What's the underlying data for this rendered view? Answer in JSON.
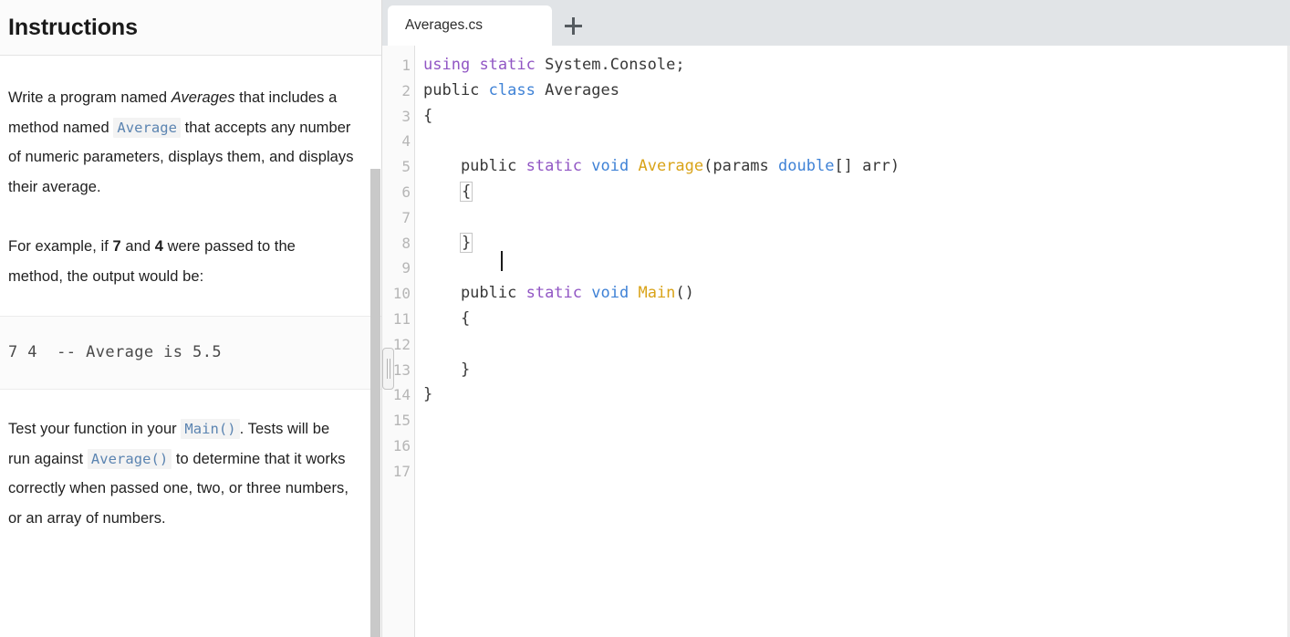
{
  "instructions": {
    "title": "Instructions",
    "paragraph1": {
      "before_em": "Write a program named ",
      "em": "Averages",
      "after_em": " that includes a method named ",
      "code": "Average",
      "tail": " that accepts any number of numeric parameters, displays them, and displays their average."
    },
    "paragraph2": {
      "before_b1": "For example, if ",
      "b1": "7",
      "between": " and ",
      "b2": "4",
      "tail": " were passed to the method, the output would be:"
    },
    "sample_output": "7 4  -- Average is 5.5",
    "paragraph3": {
      "before_code1": "Test your function in your ",
      "code1": "Main()",
      "between_codes": ". Tests will be run against ",
      "code2": "Average()",
      "tail": " to determine that it works correctly when passed one, two, or three numbers, or an array of numbers."
    }
  },
  "editor": {
    "tabs": [
      {
        "label": "Averages.cs",
        "active": true
      }
    ],
    "new_tab_icon": "plus-icon",
    "splitter_icon": "drag-handle-icon",
    "line_numbers": [
      "1",
      "2",
      "3",
      "4",
      "5",
      "6",
      "7",
      "8",
      "9",
      "10",
      "11",
      "12",
      "13",
      "14",
      "15",
      "16",
      "17"
    ],
    "code_lines": [
      {
        "n": 1,
        "tokens": [
          {
            "t": "using",
            "c": "kw-purple"
          },
          {
            "t": " ",
            "c": "plain"
          },
          {
            "t": "static",
            "c": "kw-purple"
          },
          {
            "t": " System.Console;",
            "c": "plain"
          }
        ]
      },
      {
        "n": 2,
        "tokens": [
          {
            "t": "public ",
            "c": "plain"
          },
          {
            "t": "class",
            "c": "kw-blue"
          },
          {
            "t": " Averages",
            "c": "plain"
          }
        ]
      },
      {
        "n": 3,
        "tokens": [
          {
            "t": "{",
            "c": "plain"
          }
        ]
      },
      {
        "n": 4,
        "tokens": []
      },
      {
        "n": 5,
        "tokens": [
          {
            "t": "    public ",
            "c": "plain"
          },
          {
            "t": "static",
            "c": "kw-purple"
          },
          {
            "t": " ",
            "c": "plain"
          },
          {
            "t": "void",
            "c": "kw-blue"
          },
          {
            "t": " ",
            "c": "plain"
          },
          {
            "t": "Average",
            "c": "fn-gold"
          },
          {
            "t": "(params ",
            "c": "plain"
          },
          {
            "t": "double",
            "c": "kw-blue"
          },
          {
            "t": "[] arr)",
            "c": "plain"
          }
        ]
      },
      {
        "n": 6,
        "tokens": [
          {
            "t": "    ",
            "c": "plain"
          },
          {
            "t": "{",
            "c": "plain",
            "brace": true
          }
        ]
      },
      {
        "n": 7,
        "tokens": []
      },
      {
        "n": 8,
        "tokens": [
          {
            "t": "    ",
            "c": "plain"
          },
          {
            "t": "}",
            "c": "plain",
            "brace": true
          }
        ]
      },
      {
        "n": 9,
        "tokens": []
      },
      {
        "n": 10,
        "tokens": [
          {
            "t": "    public ",
            "c": "plain"
          },
          {
            "t": "static",
            "c": "kw-purple"
          },
          {
            "t": " ",
            "c": "plain"
          },
          {
            "t": "void",
            "c": "kw-blue"
          },
          {
            "t": " ",
            "c": "plain"
          },
          {
            "t": "Main",
            "c": "fn-gold"
          },
          {
            "t": "()",
            "c": "plain"
          }
        ]
      },
      {
        "n": 11,
        "tokens": [
          {
            "t": "    {",
            "c": "plain"
          }
        ]
      },
      {
        "n": 12,
        "tokens": []
      },
      {
        "n": 13,
        "tokens": [
          {
            "t": "    }",
            "c": "plain"
          }
        ]
      },
      {
        "n": 14,
        "tokens": [
          {
            "t": "}",
            "c": "plain"
          }
        ]
      },
      {
        "n": 15,
        "tokens": []
      },
      {
        "n": 16,
        "tokens": []
      },
      {
        "n": 17,
        "tokens": []
      }
    ]
  },
  "colors": {
    "keyword_purple": "#9156c4",
    "keyword_blue": "#3f82d6",
    "function_gold": "#d9a318",
    "code_plain": "#383838",
    "inline_code": "#5b84b1",
    "gutter_number": "#b6b6b6",
    "tabbar_bg": "#e1e4e7"
  }
}
